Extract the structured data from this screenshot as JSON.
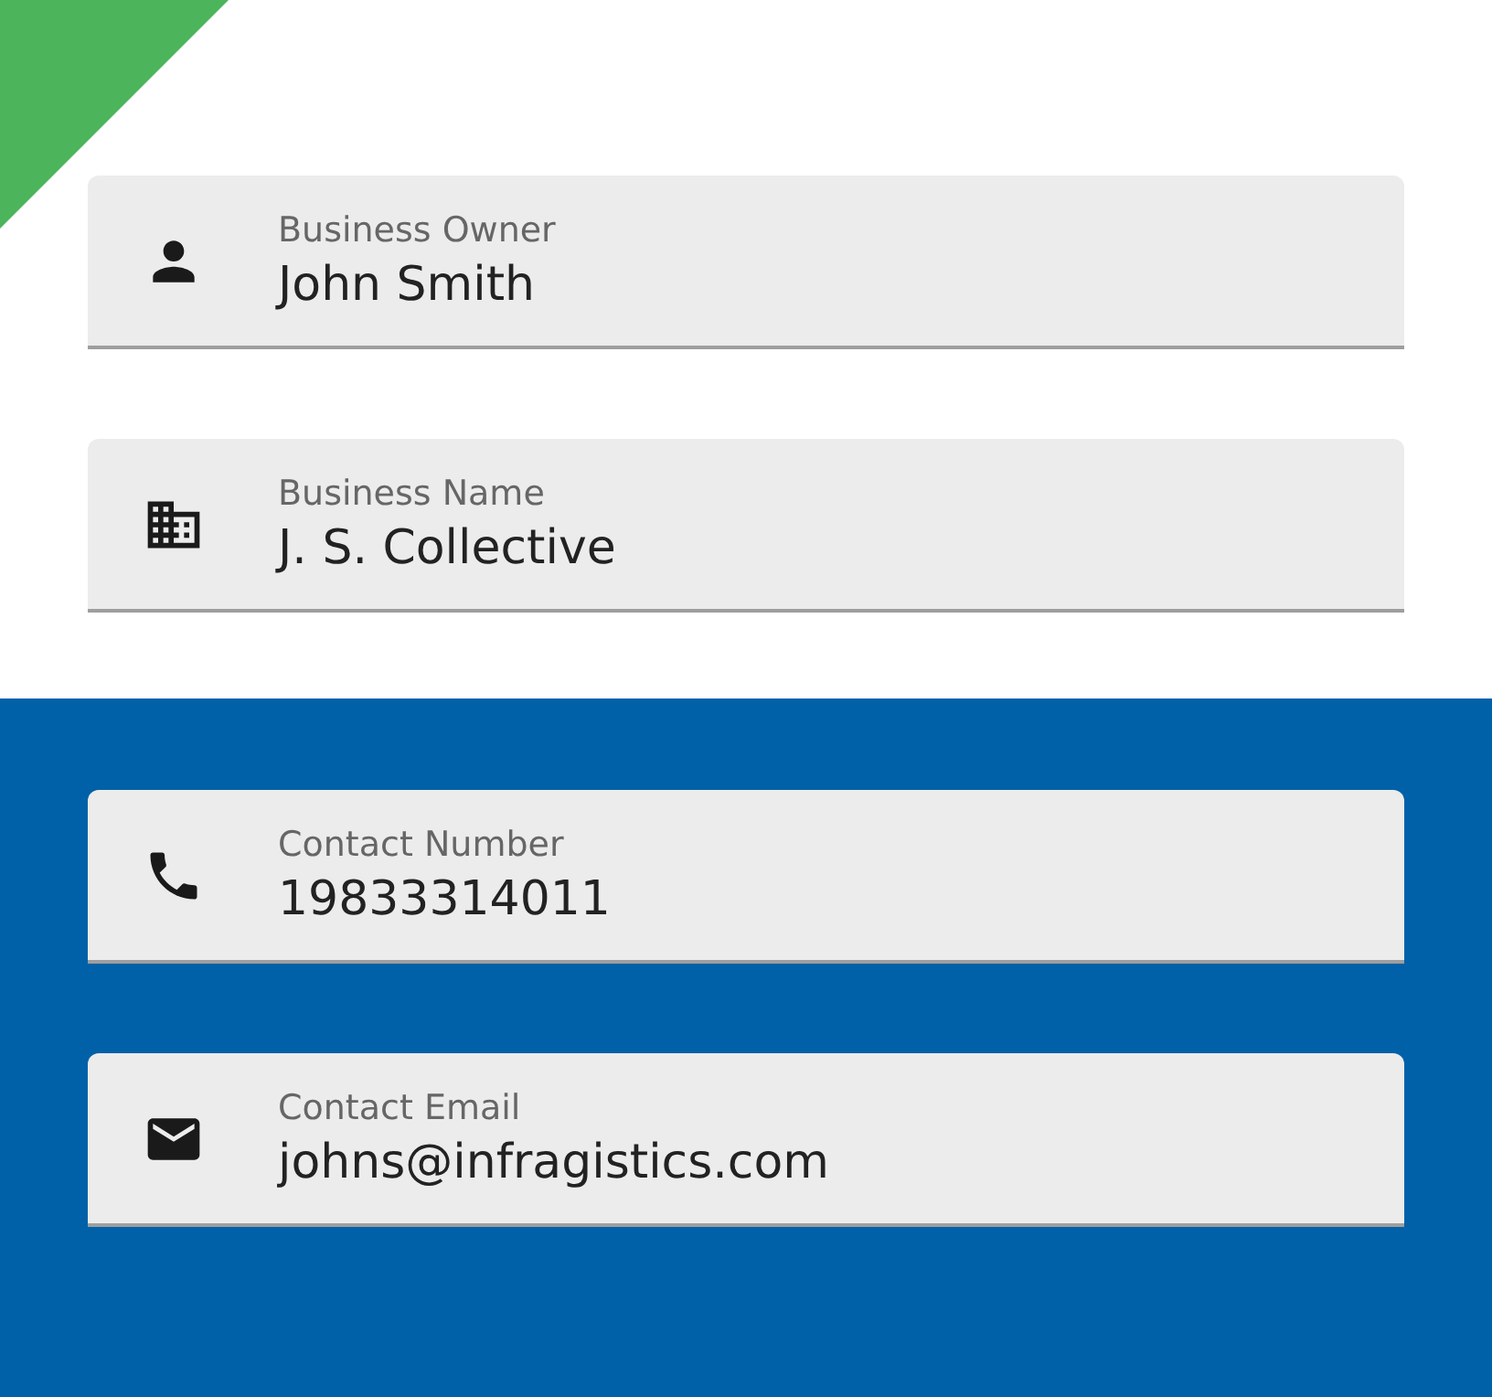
{
  "top_fields": [
    {
      "kind": "person",
      "label": "Business Owner",
      "value": "John Smith"
    },
    {
      "kind": "building",
      "label": "Business Name",
      "value": "J. S. Collective"
    }
  ],
  "bottom_fields": [
    {
      "kind": "phone",
      "label": "Contact Number",
      "value": "19833314011"
    },
    {
      "kind": "email",
      "label": "Contact Email",
      "value": "johns@infragistics.com"
    }
  ]
}
